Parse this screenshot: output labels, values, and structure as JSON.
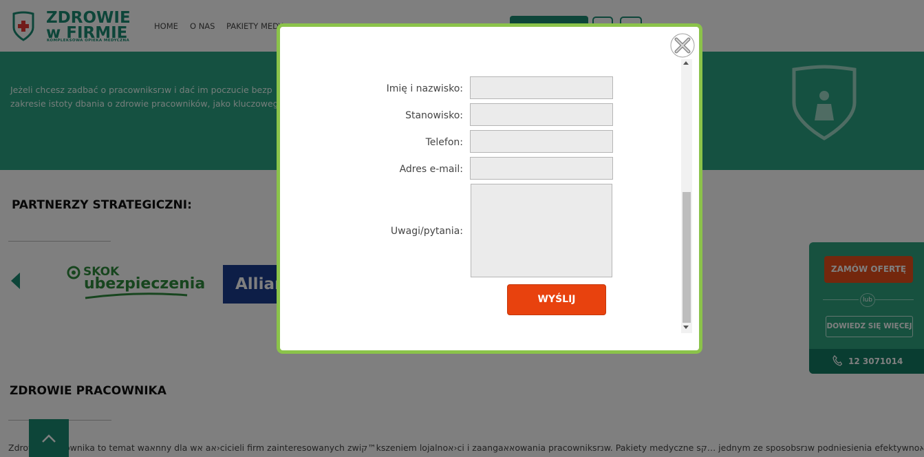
{
  "header": {
    "logo_line1": "ZDROWIE",
    "logo_line2": "w FIRMIE",
    "logo_subtitle": "KOMPLEKSOWA OPIEKA MEDYCZNA",
    "nav": [
      "HOME",
      "O NAS",
      "PAKIETY MEDY"
    ]
  },
  "banner": {
    "line1": "Jeżeli chcesz zadbać o pracowniksrנw i dać im poczucie bezp",
    "line2": "zakresie istoty dbania o zdrowie pracowników, jako kluczowego"
  },
  "partners": {
    "title": "PARTNERZY STRATEGICZNI:",
    "skok_line1": "SKOK",
    "skok_line2": "ubezpieczenia",
    "allianz": "Allianz"
  },
  "section": {
    "title": "ZDROWIE PRACOWNIKA",
    "body": "Zdrowie pracownika to temat waאnny dla wא aא›cicieli firm zainteresowanych zwiק™kszeniem lojalnoא›ci i zaangaאאowania pracowniksrנw. Pakiety medyczne sק… jednym ze sposobsrנw podniesienia efektywnoא›ci"
  },
  "side_widget": {
    "order_label": "ZAMÓW OFERTĘ",
    "lub": "lub",
    "learn_label": "DOWIEDZ SIĘ WIĘCEJ",
    "phone": "12 3071014"
  },
  "modal": {
    "form": {
      "name_label": "Imię i nazwisko:",
      "position_label": "Stanowisko:",
      "phone_label": "Telefon:",
      "email_label": "Adres e-mail:",
      "notes_label": "Uwagi/pytania:",
      "submit_label": "WYŚLIJ"
    }
  },
  "colors": {
    "brand_green": "#1a8a73",
    "banner_green": "#2aa283",
    "modal_border": "#8bc34a",
    "submit_orange": "#e8420e",
    "side_order_orange": "#e94e1b"
  }
}
